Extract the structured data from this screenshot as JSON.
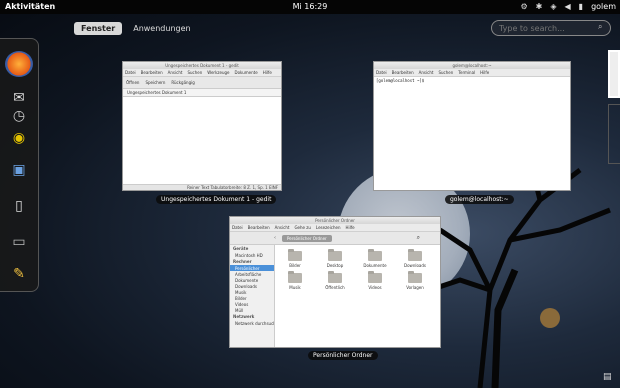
{
  "topbar": {
    "activities": "Aktivitäten",
    "clock": "Mi 16:29",
    "user": "golem",
    "tray_icons": [
      "bluetooth-icon",
      "network-icon",
      "volume-icon",
      "battery-icon"
    ]
  },
  "overview": {
    "tabs": [
      "Fenster",
      "Anwendungen"
    ],
    "active_tab": "Fenster",
    "search_placeholder": "Type to search..."
  },
  "dash": {
    "items": [
      "firefox-icon",
      "mail-icon",
      "clock-icon",
      "speaker-icon",
      "photos-icon",
      "files-icon",
      "screen-icon",
      "editor-icon"
    ]
  },
  "windows": {
    "gedit": {
      "caption": "Ungespeichertes Dokument 1 - gedit",
      "title": "Ungespeichertes Dokument 1 - gedit",
      "menu": [
        "Datei",
        "Bearbeiten",
        "Ansicht",
        "Suchen",
        "Werkzeuge",
        "Dokumente",
        "Hilfe"
      ],
      "toolbar": [
        "Öffnen",
        "Speichern",
        "Rückgängig"
      ],
      "tab": "Ungespeichertes Dokument 1",
      "status": "Reiner Text  Tabulatorbreite: 8  Z. 1, Sp. 1  EINF"
    },
    "terminal": {
      "caption": "golem@localhost:~",
      "title": "golem@localhost:~",
      "menu": [
        "Datei",
        "Bearbeiten",
        "Ansicht",
        "Suchen",
        "Terminal",
        "Hilfe"
      ],
      "prompt": "[golem@localhost ~]$"
    },
    "nautilus": {
      "caption": "Persönlicher Ordner",
      "title": "Persönlicher Ordner",
      "menu": [
        "Datei",
        "Bearbeiten",
        "Ansicht",
        "Gehe zu",
        "Lesezeichen",
        "Hilfe"
      ],
      "path": "Persönlicher Ordner",
      "sidebar": [
        {
          "type": "head",
          "label": "Geräte"
        },
        {
          "type": "item",
          "label": "Macintosh HD"
        },
        {
          "type": "head",
          "label": "Rechner"
        },
        {
          "type": "item",
          "label": "Persönlicher",
          "selected": true
        },
        {
          "type": "item",
          "label": "Arbeitsfläche"
        },
        {
          "type": "item",
          "label": "Dokumente"
        },
        {
          "type": "item",
          "label": "Downloads"
        },
        {
          "type": "item",
          "label": "Musik"
        },
        {
          "type": "item",
          "label": "Bilder"
        },
        {
          "type": "item",
          "label": "Videos"
        },
        {
          "type": "item",
          "label": "Müll"
        },
        {
          "type": "head",
          "label": "Netzwerk"
        },
        {
          "type": "item",
          "label": "Netzwerk durchsuchen"
        }
      ],
      "folders": [
        "Bilder",
        "Desktop",
        "Dokumente",
        "Downloads",
        "Musik",
        "Öffentlich",
        "Videos",
        "Vorlagen"
      ]
    }
  }
}
